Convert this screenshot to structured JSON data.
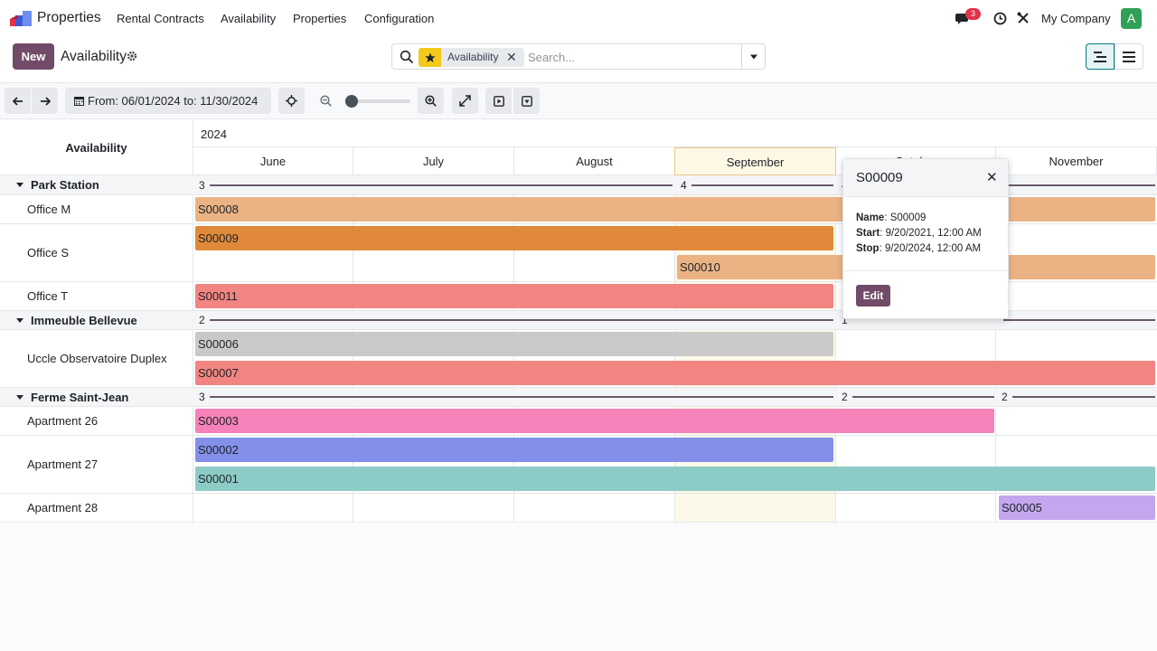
{
  "navbar": {
    "app_name": "Properties",
    "menu": [
      "Rental Contracts",
      "Availability",
      "Properties",
      "Configuration"
    ],
    "messages_count": "3",
    "company": "My Company",
    "avatar_letter": "A"
  },
  "control_panel": {
    "new_label": "New",
    "title": "Availability",
    "facet_label": "Availability",
    "search_placeholder": "Search..."
  },
  "toolbar": {
    "range_label": "From: 06/01/2024 to: 11/30/2024"
  },
  "gantt": {
    "header_title": "Availability",
    "year": "2024",
    "months": [
      "June",
      "July",
      "August",
      "September",
      "October",
      "November"
    ],
    "groups": [
      {
        "name": "Park Station",
        "counts": [
          "3",
          "4",
          "4"
        ]
      },
      {
        "name": "Immeuble Bellevue",
        "counts": [
          "2",
          "1"
        ]
      },
      {
        "name": "Ferme Saint-Jean",
        "counts": [
          "3",
          "2",
          "2"
        ]
      }
    ],
    "rows": [
      "Office M",
      "Office S",
      "Office T",
      "Uccle Observatoire Duplex",
      "Apartment 26",
      "Apartment 27",
      "Apartment 28"
    ],
    "pills": [
      "S00008",
      "S00009",
      "S00010",
      "S00011",
      "S00006",
      "S00007",
      "S00003",
      "S00002",
      "S00001",
      "S00005"
    ]
  },
  "popover": {
    "title": "S00009",
    "name_label": "Name",
    "name_value": "S00009",
    "start_label": "Start",
    "start_value": "9/20/2021, 12:00 AM",
    "stop_label": "Stop",
    "stop_value": "9/20/2024, 12:00 AM",
    "edit_label": "Edit"
  },
  "colors": {
    "brand": "#714b67",
    "pill_orange_light": "#ebb384",
    "pill_orange": "#e0893a",
    "pill_red": "#f28482",
    "pill_grey": "#c9c9c9",
    "pill_pink": "#f582b8",
    "pill_blue": "#838fe8",
    "pill_teal": "#8ccbc6",
    "pill_purple": "#c3a7ee"
  }
}
